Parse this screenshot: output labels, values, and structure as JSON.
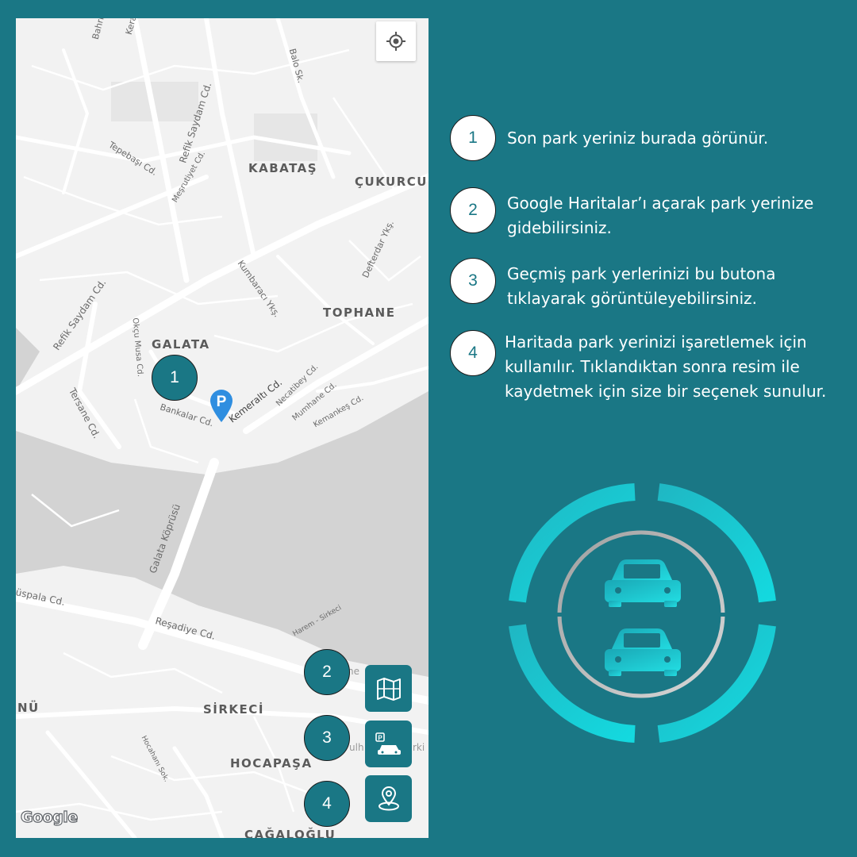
{
  "map": {
    "districts": {
      "kabatas": "KABATAŞ",
      "cukurcuma": "ÇUKURCU",
      "tophane": "TOPHANE",
      "galata": "GALATA",
      "sirkeci": "SİRKECİ",
      "hocapasa": "HOCAPAŞA",
      "cagaloglu": "CAĞALOĞLU",
      "nu": "NÜ"
    },
    "streets": {
      "bahri": "Bahri",
      "kera": "Kera",
      "balo": "Balo Sk.",
      "refik1": "Refik Saydam Cd.",
      "tepebasi": "Tepebaşı Cd.",
      "mesrutiyet": "Meşrutiyet Cd.",
      "defterdar": "Defterdar Ykş.",
      "kumbaraci": "Kumbaracı Ykş.",
      "refik2": "Refik Saydam Cd.",
      "okcu": "Okçu Musa Cd.",
      "tersane": "Tersane Cd.",
      "kemeralti": "Kemeraltı Cd.",
      "necatibey": "Necatibey Cd.",
      "mumhane": "Mumhane Cd.",
      "kemankes": "Kemankeş Cd.",
      "bankalar": "Bankalar Cd.",
      "galata_bridge": "Galata Köprüsü",
      "uspala": "üspala Cd.",
      "resadiye": "Reşadiye Cd.",
      "harem": "Harem - Sirkeci",
      "hocahani": "Hocahanı Sok.",
      "ne": "ne",
      "ulh": "ulh",
      "rki": "rki"
    },
    "google": "Google",
    "markers": {
      "one": "1",
      "two": "2",
      "three": "3",
      "four": "4"
    }
  },
  "buttons": {
    "locate_icon": "crosshair-icon",
    "maps_icon": "folded-map-icon",
    "history_icon": "parking-car-icon",
    "mark_icon": "location-pin-icon"
  },
  "steps": [
    {
      "num": "1",
      "text": "Son park yeriniz burada görünür."
    },
    {
      "num": "2",
      "text": "Google Haritalar’ı açarak park yerinize gidebilirsiniz."
    },
    {
      "num": "3",
      "text": "Geçmiş park yerlerinizi bu butona tıklayarak görüntüleyebilirsiniz."
    },
    {
      "num": "4",
      "text": "Haritada park yerinizi işaretlemek için kullanılır. Tıklandıktan sonra resim ile kaydetmek için size bir seçenek sunulur."
    }
  ],
  "colors": {
    "background": "#1a7785",
    "accent": "#19d0d8",
    "map_bg": "#f2f2f2",
    "water": "#d2d2d2",
    "pin": "#2f8ee0"
  }
}
